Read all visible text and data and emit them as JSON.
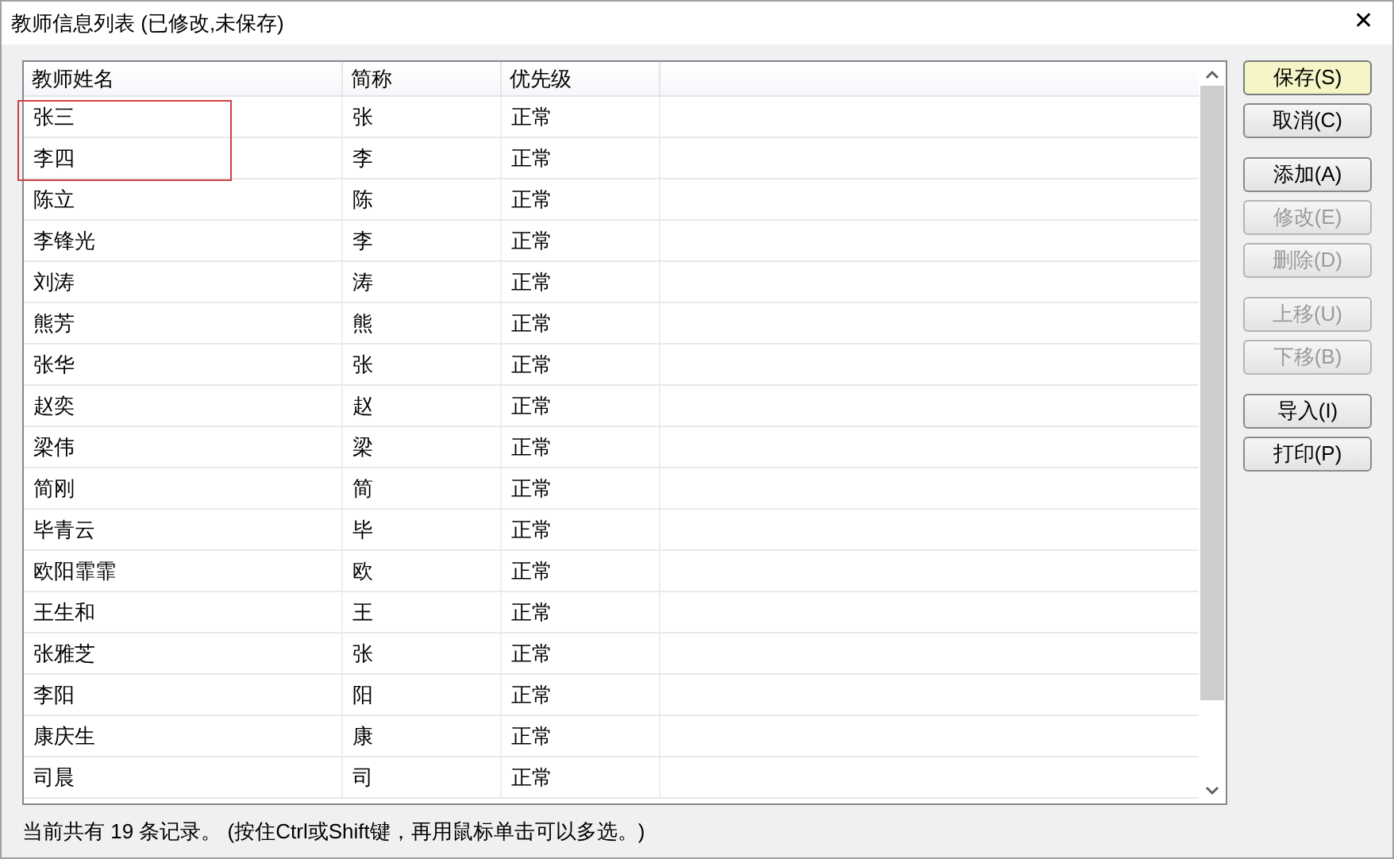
{
  "window": {
    "title": "教师信息列表 (已修改,未保存)",
    "close": "✕"
  },
  "table": {
    "columns": [
      "教师姓名",
      "简称",
      "优先级"
    ],
    "rows": [
      {
        "cells": [
          "张三",
          "张",
          "正常"
        ]
      },
      {
        "cells": [
          "李四",
          "李",
          "正常"
        ]
      },
      {
        "cells": [
          "陈立",
          "陈",
          "正常"
        ]
      },
      {
        "cells": [
          "李锋光",
          "李",
          "正常"
        ]
      },
      {
        "cells": [
          "刘涛",
          "涛",
          "正常"
        ]
      },
      {
        "cells": [
          "熊芳",
          "熊",
          "正常"
        ]
      },
      {
        "cells": [
          "张华",
          "张",
          "正常"
        ]
      },
      {
        "cells": [
          "赵奕",
          "赵",
          "正常"
        ]
      },
      {
        "cells": [
          "梁伟",
          "梁",
          "正常"
        ]
      },
      {
        "cells": [
          "简刚",
          "简",
          "正常"
        ]
      },
      {
        "cells": [
          "毕青云",
          "毕",
          "正常"
        ]
      },
      {
        "cells": [
          "欧阳霏霏",
          "欧",
          "正常"
        ]
      },
      {
        "cells": [
          "王生和",
          "王",
          "正常"
        ]
      },
      {
        "cells": [
          "张雅芝",
          "张",
          "正常"
        ]
      },
      {
        "cells": [
          "李阳",
          "阳",
          "正常"
        ]
      },
      {
        "cells": [
          "康庆生",
          "康",
          "正常"
        ]
      },
      {
        "cells": [
          "司晨",
          "司",
          "正常"
        ]
      }
    ]
  },
  "button_groups": [
    [
      {
        "label": "保存(S)",
        "default": true,
        "disabled": false
      },
      {
        "label": "取消(C)",
        "default": false,
        "disabled": false
      }
    ],
    [
      {
        "label": "添加(A)",
        "default": false,
        "disabled": false
      },
      {
        "label": "修改(E)",
        "default": false,
        "disabled": true
      },
      {
        "label": "删除(D)",
        "default": false,
        "disabled": true
      }
    ],
    [
      {
        "label": "上移(U)",
        "default": false,
        "disabled": true
      },
      {
        "label": "下移(B)",
        "default": false,
        "disabled": true
      }
    ],
    [
      {
        "label": "导入(I)",
        "default": false,
        "disabled": false
      },
      {
        "label": "打印(P)",
        "default": false,
        "disabled": false
      }
    ]
  ],
  "status_bar": "当前共有 19 条记录。 (按住Ctrl或Shift键，再用鼠标单击可以多选。)"
}
